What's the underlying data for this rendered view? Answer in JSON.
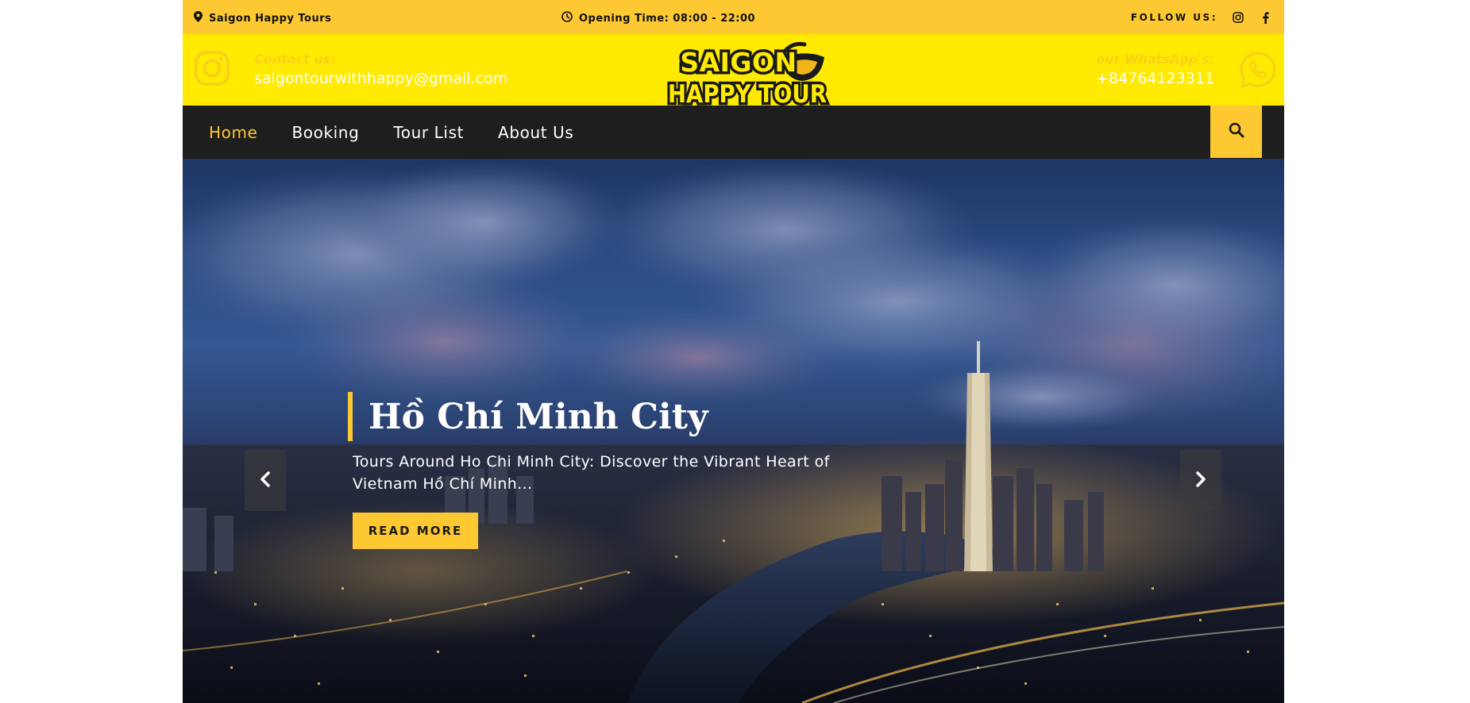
{
  "topbar": {
    "location": "Saigon Happy Tours",
    "opening_time": "Opening Time: 08:00 - 22:00",
    "follow_label": "FOLLOW US:"
  },
  "contact": {
    "email_label": "Contact us:",
    "email": "saigontourwithhappy@gmail.com",
    "whatsapp_label": "our WhatsApp's:",
    "whatsapp": "+84764123311"
  },
  "logo": {
    "line1": "SAIGON",
    "line2": "HAPPY TOUR"
  },
  "nav": {
    "items": [
      {
        "label": "Home",
        "active": true
      },
      {
        "label": "Booking"
      },
      {
        "label": "Tour List"
      },
      {
        "label": "About Us"
      }
    ]
  },
  "hero": {
    "title": "Hồ Chí Minh City",
    "description": "Tours Around Ho Chi Minh City: Discover the Vibrant Heart of Vietnam Hồ Chí Minh...",
    "cta": "READ MORE"
  },
  "colors": {
    "accent": "#fdc832",
    "contact_band": "#ffea00",
    "nav_bg": "#1e1e1e"
  },
  "icons": {
    "location": "map-pin-icon",
    "clock": "clock-icon",
    "instagram": "instagram-icon",
    "facebook": "facebook-icon",
    "whatsapp": "whatsapp-icon",
    "search": "search-icon",
    "prev": "chevron-left-icon",
    "next": "chevron-right-icon"
  }
}
